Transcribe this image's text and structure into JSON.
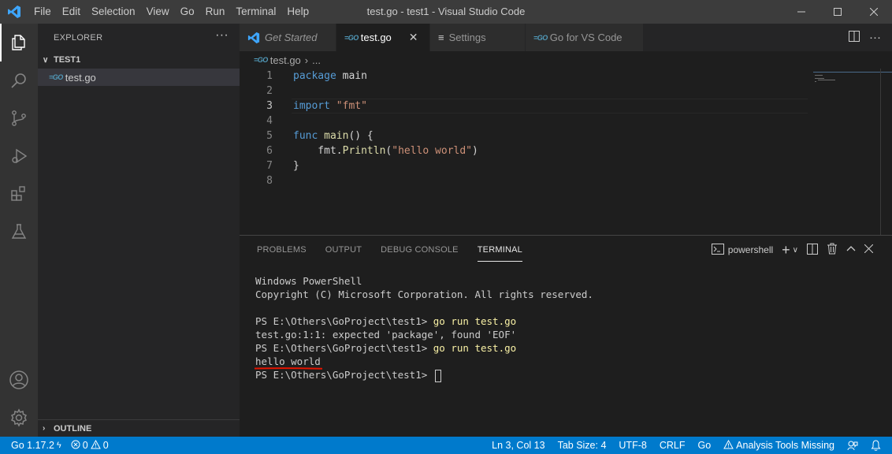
{
  "app": {
    "window_title": "test.go - test1 - Visual Studio Code",
    "menu": [
      "File",
      "Edit",
      "Selection",
      "View",
      "Go",
      "Run",
      "Terminal",
      "Help"
    ]
  },
  "sidebar": {
    "header": "EXPLORER",
    "more": "···",
    "folder": "TEST1",
    "files": [
      {
        "name": "test.go",
        "icon": "go-file-icon"
      }
    ],
    "outline": "OUTLINE"
  },
  "tabs": [
    {
      "label": "Get Started",
      "icon": "vscode-icon"
    },
    {
      "label": "test.go",
      "icon": "go-file-icon",
      "active": true,
      "close": "✕"
    },
    {
      "label": "Settings",
      "icon": "settings-list-icon"
    },
    {
      "label": "Go for VS Code",
      "icon": "go-file-icon"
    }
  ],
  "breadcrumb": {
    "file": "test.go",
    "sep": "›",
    "rest": "..."
  },
  "editor": {
    "lines": [
      {
        "n": "1",
        "tokens": [
          {
            "t": "package",
            "c": "kw"
          },
          {
            "t": " main",
            "c": ""
          }
        ]
      },
      {
        "n": "2",
        "tokens": []
      },
      {
        "n": "3",
        "tokens": [
          {
            "t": "import",
            "c": "kw"
          },
          {
            "t": " ",
            "c": ""
          },
          {
            "t": "\"fmt\"",
            "c": "str"
          }
        ]
      },
      {
        "n": "4",
        "tokens": []
      },
      {
        "n": "5",
        "tokens": [
          {
            "t": "func",
            "c": "kw"
          },
          {
            "t": " ",
            "c": ""
          },
          {
            "t": "main",
            "c": "fn"
          },
          {
            "t": "() {",
            "c": ""
          }
        ]
      },
      {
        "n": "6",
        "tokens": [
          {
            "t": "    fmt.",
            "c": ""
          },
          {
            "t": "Println",
            "c": "fn"
          },
          {
            "t": "(",
            "c": ""
          },
          {
            "t": "\"hello world\"",
            "c": "str"
          },
          {
            "t": ")",
            "c": ""
          }
        ]
      },
      {
        "n": "7",
        "tokens": [
          {
            "t": "}",
            "c": ""
          }
        ]
      },
      {
        "n": "8",
        "tokens": []
      }
    ],
    "current_line": "3"
  },
  "panel": {
    "tabs": [
      "PROBLEMS",
      "OUTPUT",
      "DEBUG CONSOLE",
      "TERMINAL"
    ],
    "active_tab": "TERMINAL",
    "terminal_name": "powershell",
    "terminal_lines": [
      {
        "text": "Windows PowerShell"
      },
      {
        "text": "Copyright (C) Microsoft Corporation. All rights reserved."
      },
      {
        "text": ""
      },
      {
        "prompt": "PS E:\\Others\\GoProject\\test1> ",
        "cmd": "go run test.go"
      },
      {
        "text": "test.go:1:1: expected 'package', found 'EOF'"
      },
      {
        "prompt": "PS E:\\Others\\GoProject\\test1> ",
        "cmd": "go run test.go"
      },
      {
        "text": "hello world",
        "underline": true
      },
      {
        "prompt": "PS E:\\Others\\GoProject\\test1> ",
        "cursor": true
      }
    ]
  },
  "statusbar": {
    "go_version": "Go 1.17.2",
    "errors": "0",
    "warnings": "0",
    "position": "Ln 3, Col 13",
    "tab_size": "Tab Size: 4",
    "encoding": "UTF-8",
    "eol": "CRLF",
    "language": "Go",
    "analysis": "Analysis Tools Missing"
  },
  "colors": {
    "accent": "#007acc",
    "keyword": "#569cd6",
    "string": "#ce9178",
    "function": "#dcdcaa",
    "underline": "#e51400"
  }
}
